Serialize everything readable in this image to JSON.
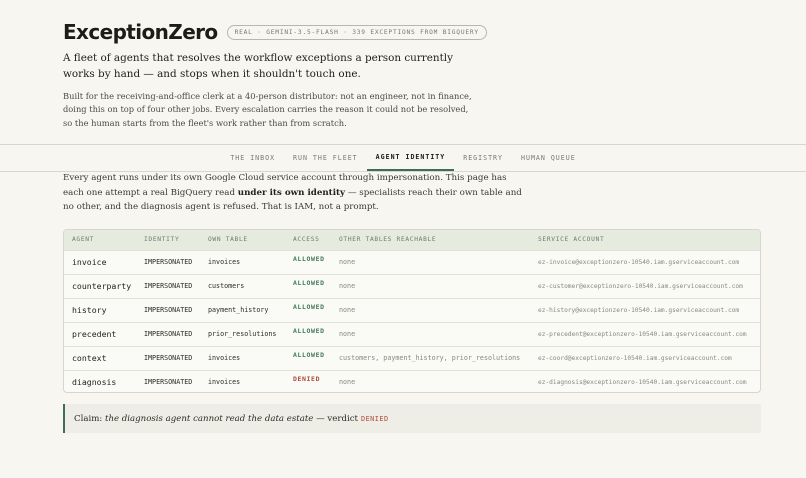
{
  "header": {
    "brand": "ExceptionZero",
    "badge": "REAL · GEMINI-3.5-FLASH · 339 EXCEPTIONS FROM BIGQUERY",
    "tagline": "A fleet of agents that resolves the workflow exceptions a person currently works by hand — and stops when it shouldn't touch one.",
    "intro": "Built for the receiving-and-office clerk at a 40-person distributor: not an engineer, not in finance, doing this on top of four other jobs. Every escalation carries the reason it could not be resolved, so the human starts from the fleet's work rather than from scratch."
  },
  "nav": {
    "tabs": [
      {
        "label": "THE INBOX",
        "active": false
      },
      {
        "label": "RUN THE FLEET",
        "active": false
      },
      {
        "label": "AGENT IDENTITY",
        "active": true
      },
      {
        "label": "REGISTRY",
        "active": false
      },
      {
        "label": "HUMAN QUEUE",
        "active": false
      }
    ]
  },
  "identity": {
    "desc_part1": "Every agent runs under its own Google Cloud service account through impersonation. This page has each one attempt a real BigQuery read ",
    "desc_bold": "under its own identity",
    "desc_part2": " — specialists reach their own table and no other, and the diagnosis agent is refused. That is IAM, not a prompt.",
    "columns": [
      "AGENT",
      "IDENTITY",
      "OWN TABLE",
      "ACCESS",
      "OTHER TABLES REACHABLE",
      "SERVICE ACCOUNT"
    ],
    "rows": [
      {
        "agent": "invoice",
        "identity": "IMPERSONATED",
        "own_table": "invoices",
        "access": "ALLOWED",
        "other": "none",
        "sa": "ez-invoice@exceptionzero-10540.iam.gserviceaccount.com"
      },
      {
        "agent": "counterparty",
        "identity": "IMPERSONATED",
        "own_table": "customers",
        "access": "ALLOWED",
        "other": "none",
        "sa": "ez-customer@exceptionzero-10540.iam.gserviceaccount.com"
      },
      {
        "agent": "history",
        "identity": "IMPERSONATED",
        "own_table": "payment_history",
        "access": "ALLOWED",
        "other": "none",
        "sa": "ez-history@exceptionzero-10540.iam.gserviceaccount.com"
      },
      {
        "agent": "precedent",
        "identity": "IMPERSONATED",
        "own_table": "prior_resolutions",
        "access": "ALLOWED",
        "other": "none",
        "sa": "ez-precedent@exceptionzero-10540.iam.gserviceaccount.com"
      },
      {
        "agent": "context",
        "identity": "IMPERSONATED",
        "own_table": "invoices",
        "access": "ALLOWED",
        "other": "customers, payment_history, prior_resolutions",
        "sa": "ez-coord@exceptionzero-10540.iam.gserviceaccount.com"
      },
      {
        "agent": "diagnosis",
        "identity": "IMPERSONATED",
        "own_table": "invoices",
        "access": "DENIED",
        "other": "none",
        "sa": "ez-diagnosis@exceptionzero-10540.iam.gserviceaccount.com"
      }
    ]
  },
  "claim": {
    "prefix": "Claim: ",
    "statement": "the diagnosis agent cannot read the data estate",
    "middle": " — verdict",
    "verdict": "DENIED"
  },
  "colors": {
    "accent": "#3f6b59",
    "allowed": "#3e7a55",
    "denied": "#b04a3a",
    "background": "#f7f6f1"
  }
}
